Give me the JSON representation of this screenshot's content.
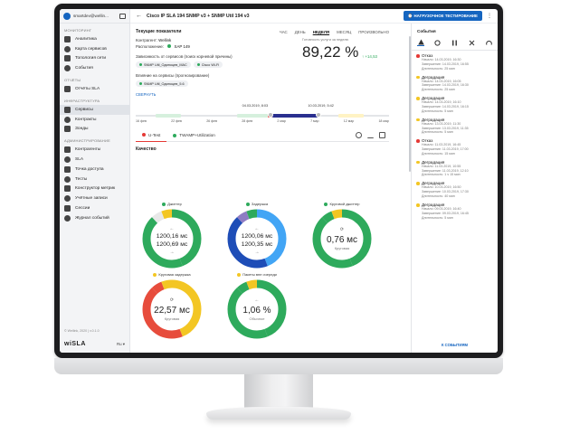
{
  "user": {
    "email": "smartdev@wellin...",
    "logout_icon": "logout-icon"
  },
  "sidebar": {
    "sections": [
      {
        "title": "МОНИТОРИНГ",
        "items": [
          {
            "label": "Аналитика",
            "icon": "pie-chart-icon",
            "active": false
          },
          {
            "label": "Карта сервисов",
            "icon": "map-icon",
            "active": false
          },
          {
            "label": "Топология сети",
            "icon": "topology-icon",
            "active": false
          },
          {
            "label": "События",
            "icon": "warning-icon",
            "active": false
          }
        ]
      },
      {
        "title": "ОТЧЁТЫ",
        "items": [
          {
            "label": "Отчёты SLA",
            "icon": "clock-icon",
            "active": false
          }
        ]
      },
      {
        "title": "ИНФРАСТРУКТУРА",
        "items": [
          {
            "label": "Сервисы",
            "icon": "list-icon",
            "active": true
          },
          {
            "label": "Контракты",
            "icon": "document-icon",
            "active": false
          },
          {
            "label": "Зонды",
            "icon": "probe-icon",
            "active": false
          }
        ]
      },
      {
        "title": "АДМИНИСТРИРОВАНИЕ",
        "items": [
          {
            "label": "Контрагенты",
            "icon": "users-icon",
            "active": false
          },
          {
            "label": "SLA",
            "icon": "chart-icon",
            "active": false
          },
          {
            "label": "Точка доступа",
            "icon": "access-point-icon",
            "active": false
          },
          {
            "label": "Тесты",
            "icon": "test-icon",
            "active": false
          },
          {
            "label": "Конструктор метрик",
            "icon": "constructor-icon",
            "active": false
          },
          {
            "label": "Учётные записи",
            "icon": "accounts-icon",
            "active": false
          },
          {
            "label": "Сессии",
            "icon": "session-icon",
            "active": false
          },
          {
            "label": "Журнал событий",
            "icon": "journal-icon",
            "active": false
          }
        ]
      }
    ],
    "footer": "© Wellink, 2020 | v.0.1.0",
    "logo": "wiSLA",
    "lang": "Ru"
  },
  "header": {
    "title": "Cisco IP SLA 194 SNMP v3 + SNMP Util 194 v3",
    "load_button": "НАГРУЗОЧНОЕ ТЕСТИРОВАНИЕ"
  },
  "current": {
    "heading": "Текущие показатели",
    "periods": [
      "ЧАС",
      "ДЕНЬ",
      "НЕДЕЛЯ",
      "МЕСЯЦ",
      "ПРОИЗВОЛЬНО"
    ],
    "active_period": "НЕДЕЛЯ",
    "contractor_label": "Контрагент:",
    "contractor_value": "Wellink",
    "location_label": "Расположение:",
    "location_value": "SAP 149",
    "dependency_label": "Зависимость от сервисов (поиск корневой причины)",
    "dependency_chips": [
      "SNMP Util_Одиноцев_MAC",
      "Cisco Wi-Fi"
    ],
    "influence_label": "Влияние на сервисы (прогнозирование)",
    "influence_chips": [
      "SNMP Util_Одиноцев_5.6"
    ],
    "collapse": "СВЕРНУТЬ",
    "availability_label": "Готовность услуги за неделю",
    "availability_value": "89,22 %",
    "availability_delta": "↑ +14,53"
  },
  "timeline": {
    "ticks": [
      "16 фев",
      "22 фев",
      "26 фев",
      "28 фев",
      "2 мар",
      "7 мар",
      "12 мар",
      "18 мар"
    ],
    "markers": [
      "04.03.2019, 8:03",
      "10.03.2019, 5:42"
    ]
  },
  "tabs": [
    {
      "label": "U-Test",
      "color": "#e53935",
      "active": true
    },
    {
      "label": "TWAMP+Utilization",
      "color": "#2eaa5c",
      "active": false
    }
  ],
  "quality": {
    "heading": "Качество",
    "metrics": [
      {
        "label": "Джиттер",
        "dot": "#2eaa5c",
        "top": "1200,16 мс",
        "bottom": "1200,69 мс",
        "sub": "",
        "icon": "arrows-icon",
        "colors": [
          "#2eaa5c",
          "#2eaa5c",
          "#e8e8e8",
          "#f3c623"
        ]
      },
      {
        "label": "Задержка",
        "dot": "#2eaa5c",
        "top": "1200,06 мс",
        "bottom": "1200,35 мс",
        "sub": "",
        "icon": "arrows-icon",
        "colors": [
          "#42a5f5",
          "#1e4db7",
          "#8e7cc3",
          "#2eaa5c"
        ]
      },
      {
        "label": "Круговой джиттер",
        "dot": "#2eaa5c",
        "top": "0,76 мс",
        "bottom": "",
        "sub": "Круговая",
        "icon": "refresh-icon",
        "colors": [
          "#2eaa5c",
          "#2eaa5c",
          "#2eaa5c",
          "#f3c623"
        ]
      },
      {
        "label": "Круговая задержка",
        "dot": "#f3c623",
        "top": "22,57 мс",
        "bottom": "",
        "sub": "Круговая",
        "icon": "refresh-icon",
        "colors": [
          "#f3c623",
          "#e74c3c",
          "#e74c3c",
          "#f3c623"
        ]
      },
      {
        "label": "Пакеты вне очереди",
        "dot": "#f3c623",
        "top": "1,06 %",
        "bottom": "",
        "sub": "Обычное",
        "icon": "arrow-icon",
        "colors": [
          "#2eaa5c",
          "#2eaa5c",
          "#2eaa5c",
          "#f3c623"
        ]
      }
    ]
  },
  "events": {
    "title": "События",
    "icons": [
      "warning-icon",
      "refresh-icon",
      "tools-icon",
      "scissors-icon",
      "gauge-icon"
    ],
    "items": [
      {
        "type": "Отказ",
        "color": "#e53935",
        "start": "Начало: 14.03.2019, 16:30",
        "end": "Завершение: 14.03.2019, 16:55",
        "dur": "Длительность: 25 мин"
      },
      {
        "type": "Деградация",
        "color": "#f3c623",
        "start": "Начало: 14.03.2019, 16:05",
        "end": "Завершение: 14.03.2019, 16:30",
        "dur": "Длительность: 25 мин"
      },
      {
        "type": "Деградация",
        "color": "#f3c623",
        "start": "Начало: 14.03.2019, 16:10",
        "end": "Завершение: 14.03.2019, 16:15",
        "dur": "Длительность: 5 мин"
      },
      {
        "type": "Деградация",
        "color": "#f3c623",
        "start": "Начало: 13.03.2019, 11:30",
        "end": "Завершение: 13.03.2019, 11:35",
        "dur": "Длительность: 5 мин"
      },
      {
        "type": "Отказ",
        "color": "#e53935",
        "start": "Начало: 11.03.2019, 16:45",
        "end": "Завершение: 11.03.2019, 17:00",
        "dur": "Длительность: 15 мин"
      },
      {
        "type": "Деградация",
        "color": "#f3c623",
        "start": "Начало: 11.03.2019, 10:55",
        "end": "Завершение: 11.03.2019, 12:10",
        "dur": "Длительность: 1 ч 15 мин"
      },
      {
        "type": "Деградация",
        "color": "#f3c623",
        "start": "Начало: 10.03.2019, 16:50",
        "end": "Завершение: 10.03.2019, 17:30",
        "dur": "Длительность: 40 мин"
      },
      {
        "type": "Деградация",
        "color": "#f3c623",
        "start": "Начало: 09.03.2019, 16:40",
        "end": "Завершение: 09.03.2019, 16:45",
        "dur": "Длительность: 5 мин"
      }
    ],
    "footer": "К СОБЫТИЯМ"
  },
  "colors": {
    "accent": "#1565c0",
    "ok": "#2eaa5c",
    "warn": "#f3c623",
    "fail": "#e53935"
  }
}
